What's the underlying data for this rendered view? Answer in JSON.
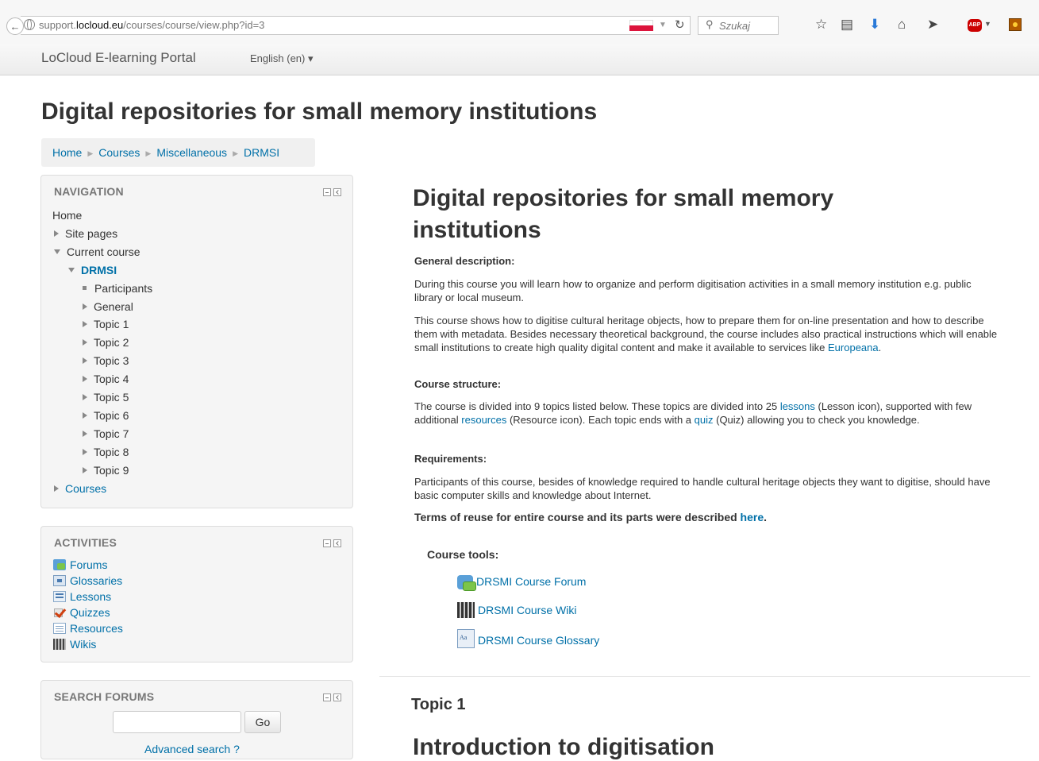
{
  "browser": {
    "url_prefix": "support.",
    "url_domain": "locloud.eu",
    "url_path": "/courses/course/view.php?id=3",
    "search_placeholder": "Szukaj",
    "abp_label": "ABP"
  },
  "navbar": {
    "brand": "LoCloud E-learning Portal",
    "language": "English (en) ▾"
  },
  "page": {
    "title": "Digital repositories for small memory institutions"
  },
  "breadcrumb": [
    "Home",
    "Courses",
    "Miscellaneous",
    "DRMSI"
  ],
  "navigation": {
    "title": "NAVIGATION",
    "home": "Home",
    "site_pages": "Site pages",
    "current_course": "Current course",
    "course_short": "DRMSI",
    "participants": "Participants",
    "general": "General",
    "topics": [
      "Topic 1",
      "Topic 2",
      "Topic 3",
      "Topic 4",
      "Topic 5",
      "Topic 6",
      "Topic 7",
      "Topic 8",
      "Topic 9"
    ],
    "courses": "Courses"
  },
  "activities": {
    "title": "ACTIVITIES",
    "items": [
      "Forums",
      "Glossaries",
      "Lessons",
      "Quizzes",
      "Resources",
      "Wikis"
    ]
  },
  "search_forums": {
    "title": "SEARCH FORUMS",
    "go_label": "Go",
    "advanced": "Advanced search ?"
  },
  "main": {
    "heading_line1": "Digital repositories for small memory",
    "heading_line2": "institutions",
    "general_description_heading": "General description:",
    "desc_p1": "During this course you will learn how to organize and perform digitisation activities in a small memory institution e.g. public library or local museum.",
    "desc_p2": "This course shows how to digitise cultural heritage objects, how to prepare them for on-line presentation and how to describe them with metadata. Besides necessary theoretical background, the course includes also practical instructions which will enable small institutions to create high quality digital content and make it available to services like ",
    "europeana_link": "Europeana",
    "period": ".",
    "course_structure_heading": "Course structure:",
    "cs_part1": "The course is divided into 9 topics listed below. These topics are divided into 25 ",
    "lessons_link": "lessons",
    "cs_part2": " (Lesson icon), supported with few additional ",
    "resources_link": "resources",
    "cs_part3": " (Resource icon). Each topic ends with a ",
    "quiz_link": "quiz",
    "cs_part4": " (Quiz) allowing you to check you knowledge.",
    "requirements_heading": "Requirements:",
    "req_p": "Participants of this course, besides of knowledge required to handle cultural heritage objects they want to digitise, should have basic computer skills and knowledge about Internet.",
    "terms_text": "Terms of reuse for entire course and its parts were described ",
    "here_link": "here",
    "course_tools_title": "Course tools:",
    "tools": [
      "DRSMI Course Forum",
      "DRSMI Course Wiki",
      "DRSMI Course Glossary"
    ],
    "topic1_title": "Topic 1",
    "topic1_lesson_heading": "Introduction to digitisation"
  },
  "colors": {
    "link": "#0070a8",
    "text": "#333333",
    "block_bg": "#f5f5f5"
  }
}
